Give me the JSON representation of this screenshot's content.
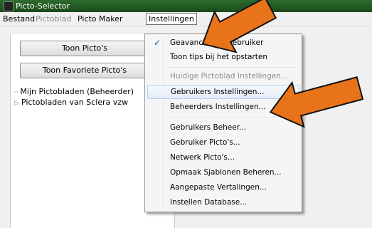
{
  "window": {
    "title": "Picto-Selector",
    "app_icon": "picto-selector-app-icon"
  },
  "menubar": {
    "bestand": "Bestand",
    "pictoblad": "Pictoblad",
    "picto_maker": "Picto Maker",
    "instellingen": "Instellingen"
  },
  "left": {
    "toon_pictos": "Toon Picto's",
    "toon_favoriete_pictos": "Toon Favoriete Picto's",
    "tree": [
      {
        "label": "Mijn Pictobladen (Beheerder)"
      },
      {
        "label": "Pictobladen van Sclera vzw"
      }
    ]
  },
  "dropdown": {
    "items": [
      {
        "label": "Geavanceerde Gebruiker",
        "checked": true
      },
      {
        "label": "Toon tips bij het opstarten"
      },
      {
        "label": "Huidige Pictoblad Instellingen...",
        "disabled": true
      },
      {
        "label": "Gebruikers Instellingen...",
        "highlighted": true
      },
      {
        "label": "Beheerders Instellingen..."
      },
      {
        "label": "Gebruikers Beheer..."
      },
      {
        "label": "Gebruiker Picto's..."
      },
      {
        "label": "Netwerk Picto's..."
      },
      {
        "label": "Opmaak Sjablonen Beheren..."
      },
      {
        "label": "Aangepaste Vertalingen..."
      },
      {
        "label": "Instellen Database..."
      }
    ]
  },
  "annotations": {
    "arrow_color": "#e8731a",
    "arrow_outline": "#111111"
  }
}
